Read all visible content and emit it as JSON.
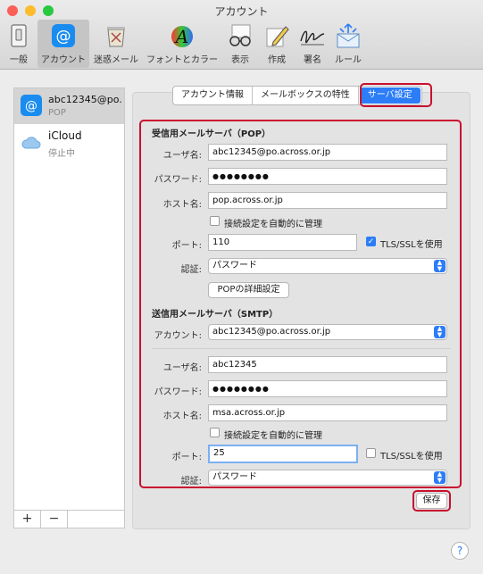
{
  "window": {
    "title": "アカウント"
  },
  "toolbar": [
    {
      "label": "一般",
      "icon": "general-icon"
    },
    {
      "label": "アカウント",
      "icon": "at-icon"
    },
    {
      "label": "迷惑メール",
      "icon": "junk-icon"
    },
    {
      "label": "フォントとカラー",
      "icon": "font-icon"
    },
    {
      "label": "表示",
      "icon": "glasses-icon"
    },
    {
      "label": "作成",
      "icon": "pen-icon"
    },
    {
      "label": "署名",
      "icon": "signature-icon"
    },
    {
      "label": "ルール",
      "icon": "rules-icon"
    }
  ],
  "accounts": [
    {
      "name": "abc12345@po...",
      "type": "POP"
    },
    {
      "name": "iCloud",
      "type": "停止中"
    }
  ],
  "sidebar": {
    "add": "+",
    "remove": "−"
  },
  "tabs": [
    "アカウント情報",
    "メールボックスの特性",
    "サーバ設定"
  ],
  "incoming": {
    "section": "受信用メールサーバ（POP）",
    "username_label": "ユーザ名:",
    "username": "abc12345@po.across.or.jp",
    "password_label": "パスワード:",
    "password": "●●●●●●●●",
    "host_label": "ホスト名:",
    "host": "pop.across.or.jp",
    "auto_manage": "接続設定を自動的に管理",
    "port_label": "ポート:",
    "port": "110",
    "tls": "TLS/SSLを使用",
    "auth_label": "認証:",
    "auth": "パスワード",
    "advanced_button": "POPの詳細設定"
  },
  "outgoing": {
    "section": "送信用メールサーバ（SMTP）",
    "account_label": "アカウント:",
    "account": "abc12345@po.across.or.jp",
    "username_label": "ユーザ名:",
    "username": "abc12345",
    "password_label": "パスワード:",
    "password": "●●●●●●●●",
    "host_label": "ホスト名:",
    "host": "msa.across.or.jp",
    "auto_manage": "接続設定を自動的に管理",
    "port_label": "ポート:",
    "port": "25",
    "tls": "TLS/SSLを使用",
    "auth_label": "認証:",
    "auth": "パスワード"
  },
  "save_button": "保存",
  "help": "?",
  "colors": {
    "accent": "#2c7df7",
    "highlight": "#c8102e"
  }
}
